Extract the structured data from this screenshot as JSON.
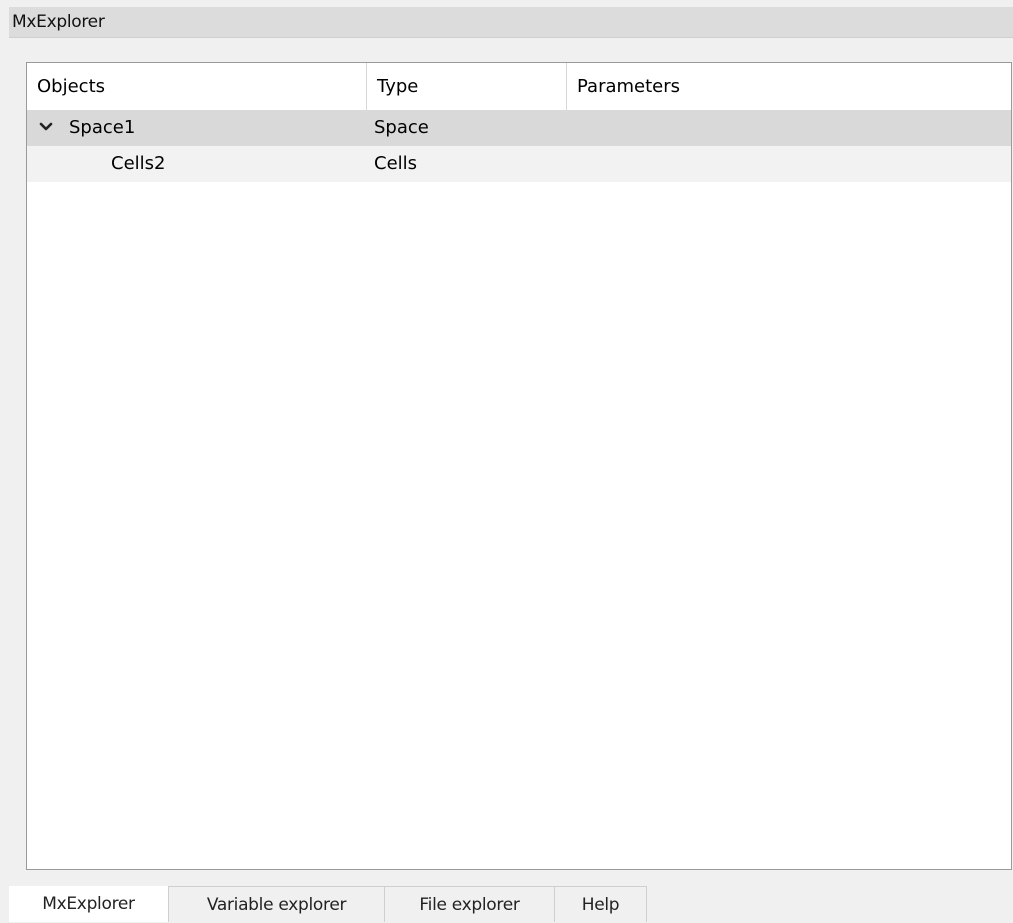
{
  "pane": {
    "title": "MxExplorer"
  },
  "tree": {
    "columns": [
      "Objects",
      "Type",
      "Parameters"
    ],
    "rows": [
      {
        "name": "Space1",
        "type": "Space",
        "parameters": "",
        "expanded": true,
        "selected": true,
        "icon": "chevron-down-icon"
      },
      {
        "name": "Cells2",
        "type": "Cells",
        "parameters": ""
      }
    ]
  },
  "tabs": [
    "MxExplorer",
    "Variable explorer",
    "File explorer",
    "Help"
  ],
  "active_tab": "MxExplorer",
  "colors": {
    "title_bar": "#dcdcdc",
    "selected_row": "#d9d9d9",
    "alt_row": "#f2f2f2",
    "background": "#f0f0f0"
  }
}
